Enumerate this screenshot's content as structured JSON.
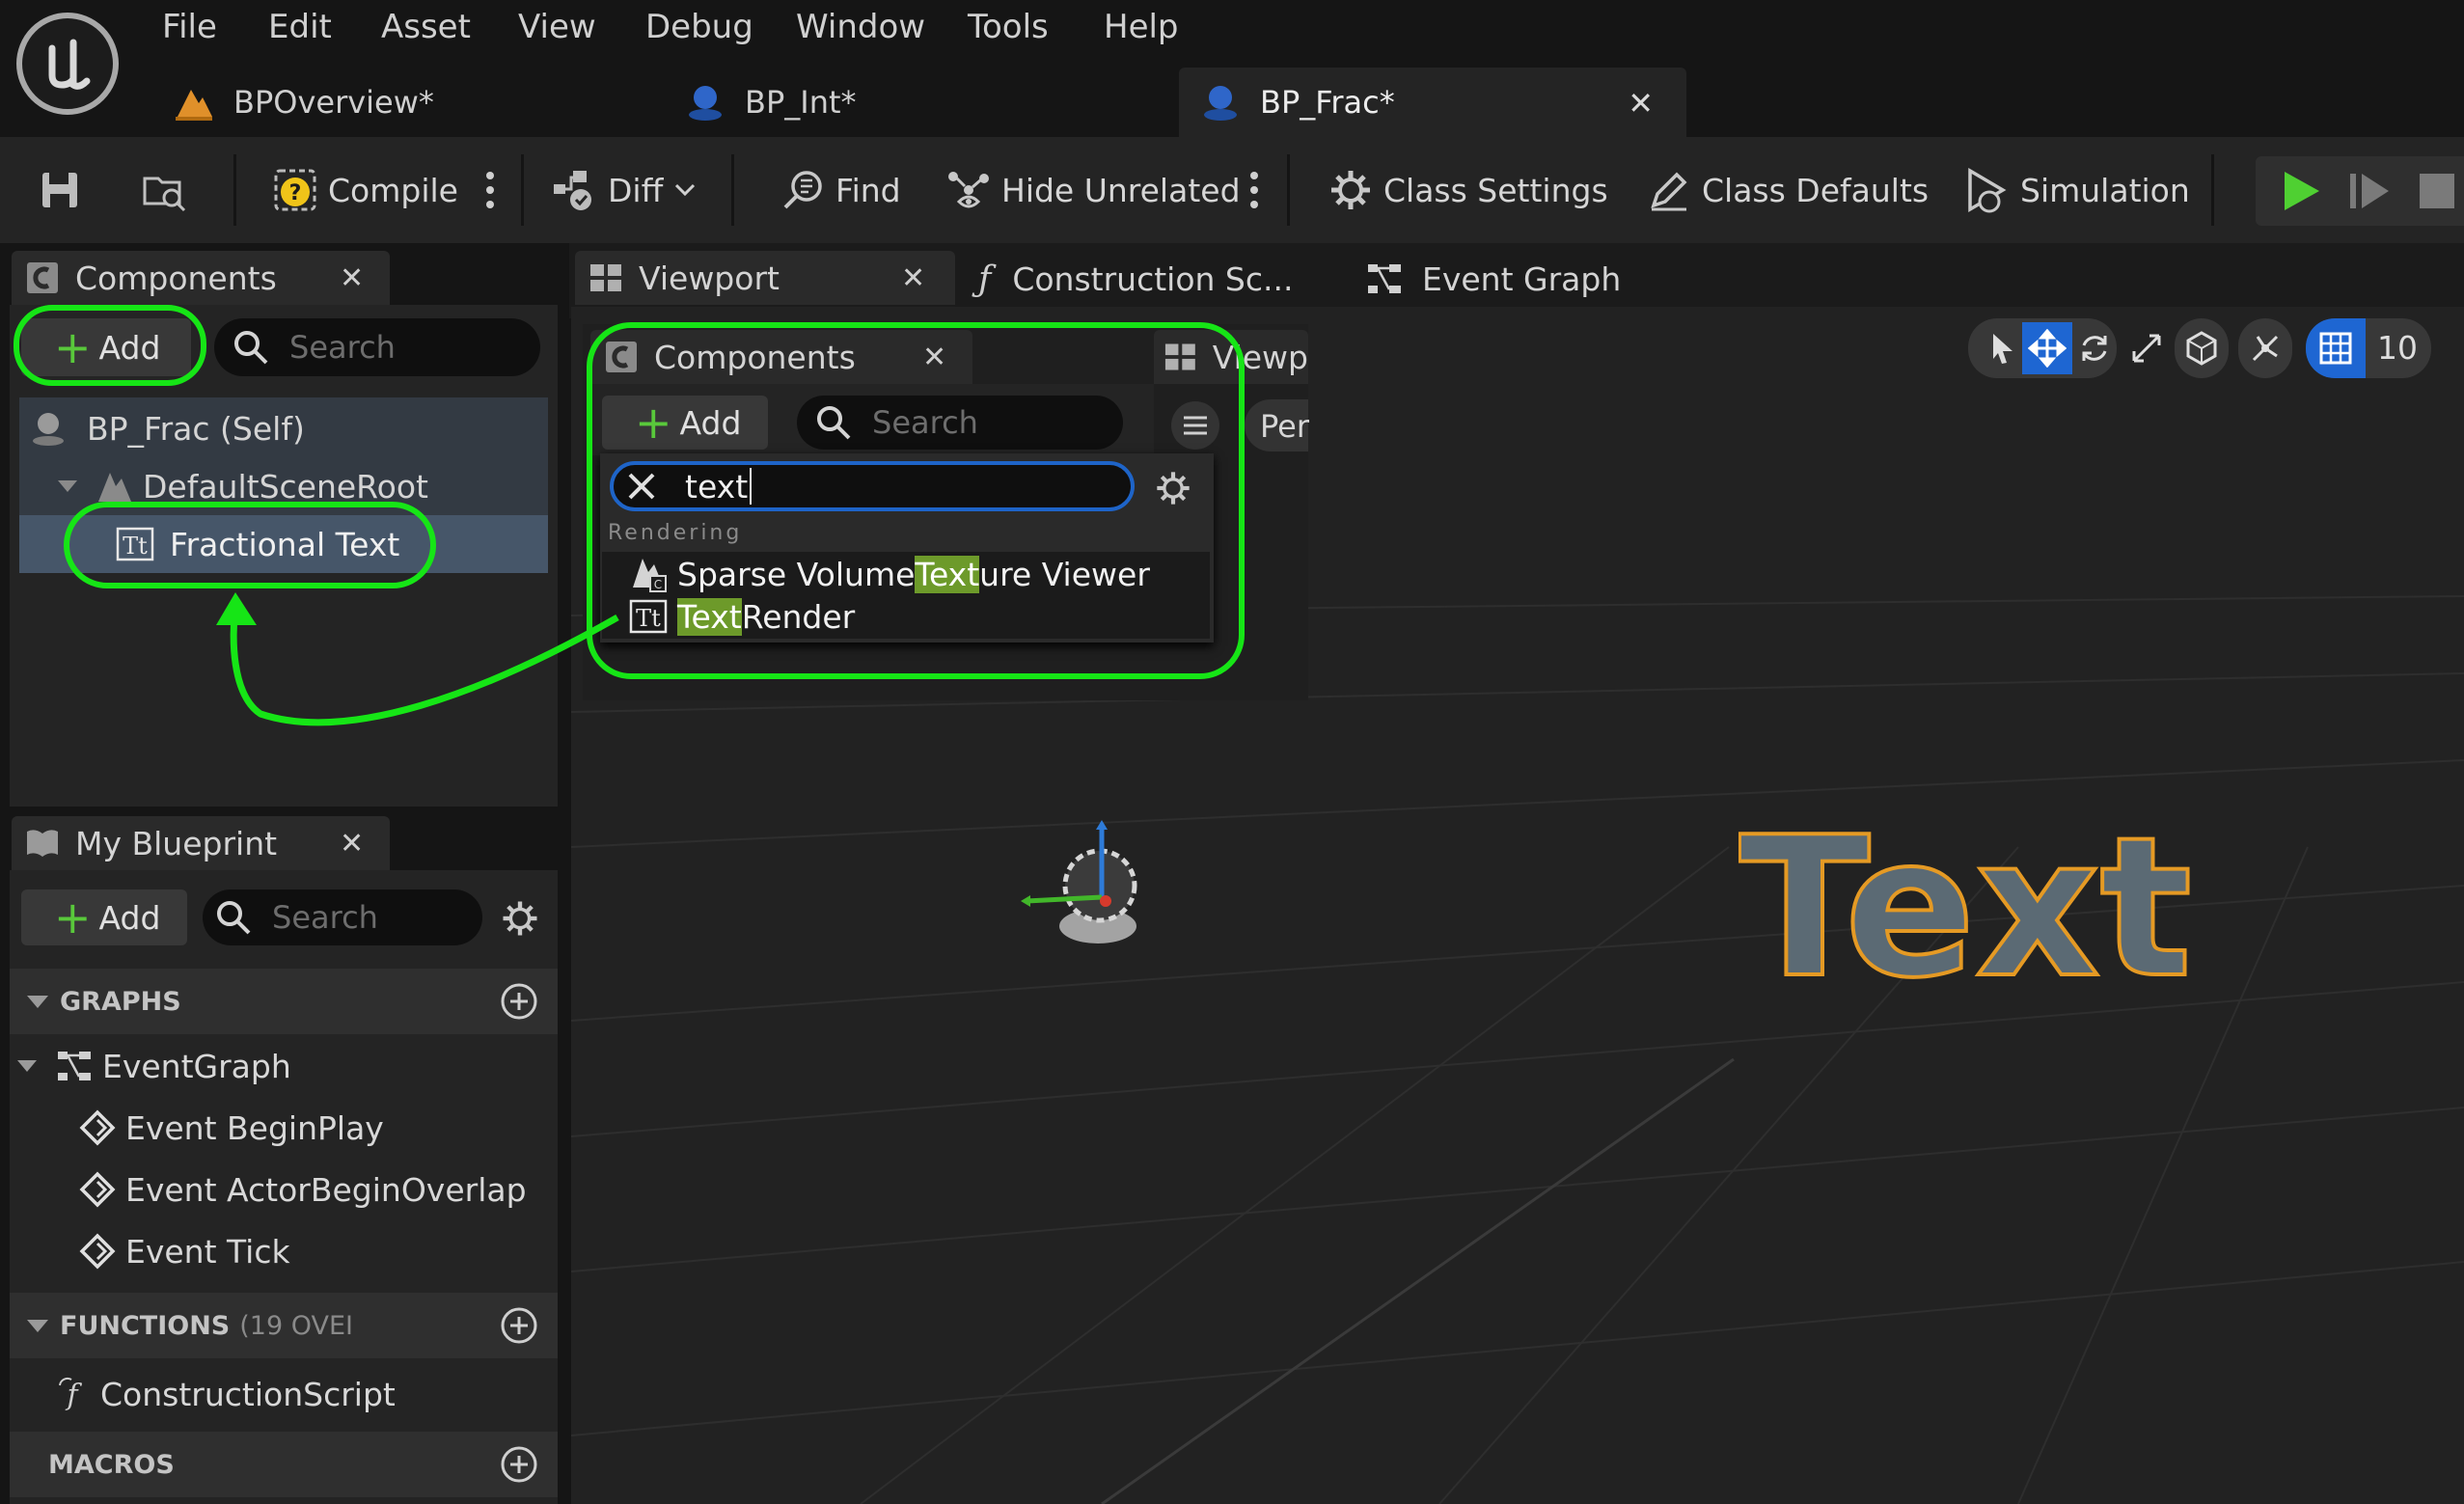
{
  "menu": [
    "File",
    "Edit",
    "Asset",
    "View",
    "Debug",
    "Window",
    "Tools",
    "Help"
  ],
  "tabs": [
    {
      "label": "BPOverview*",
      "icon": "level-icon"
    },
    {
      "label": "BP_Int*",
      "icon": "blueprint-icon"
    },
    {
      "label": "BP_Frac*",
      "icon": "blueprint-icon",
      "active": true
    }
  ],
  "toolbar": {
    "compile": "Compile",
    "diff": "Diff",
    "find": "Find",
    "hide_unrelated": "Hide Unrelated",
    "class_settings": "Class Settings",
    "class_defaults": "Class Defaults",
    "simulation": "Simulation"
  },
  "components_panel": {
    "title": "Components",
    "add": "Add",
    "search_placeholder": "Search",
    "tree": [
      {
        "label": "BP_Frac (Self)"
      },
      {
        "label": "DefaultSceneRoot"
      },
      {
        "label": "Fractional Text",
        "selected": true
      }
    ]
  },
  "editor_tabs": [
    "Viewport",
    "Construction Sc...",
    "Event Graph"
  ],
  "popup": {
    "title": "Components",
    "add": "Add",
    "search_placeholder": "Search",
    "filter_value": "text",
    "tab_partial": "Viewp",
    "view_mode_partial": "Per",
    "category": "Rendering",
    "results": [
      {
        "pre": "Sparse Volume ",
        "hl": "Text",
        "post": "ure Viewer"
      },
      {
        "pre": "",
        "hl": "Text",
        "post": " Render"
      }
    ]
  },
  "viewport": {
    "text_actor": "Text",
    "grid_partial": "10"
  },
  "my_blueprint": {
    "title": "My Blueprint",
    "add": "Add",
    "search_placeholder": "Search",
    "graphs_header": "GRAPHS",
    "event_graph": "EventGraph",
    "events": [
      "Event BeginPlay",
      "Event ActorBeginOverlap",
      "Event Tick"
    ],
    "functions_header": "FUNCTIONS",
    "functions_override": "(19 OVEI",
    "construction_script": "ConstructionScript",
    "macros_header": "MACROS"
  },
  "colors": {
    "annotation": "#16e516",
    "play": "#4fd032",
    "selection": "#465669",
    "text_actor_fill": "#5b6a74",
    "text_actor_outline": "#e59a24"
  }
}
